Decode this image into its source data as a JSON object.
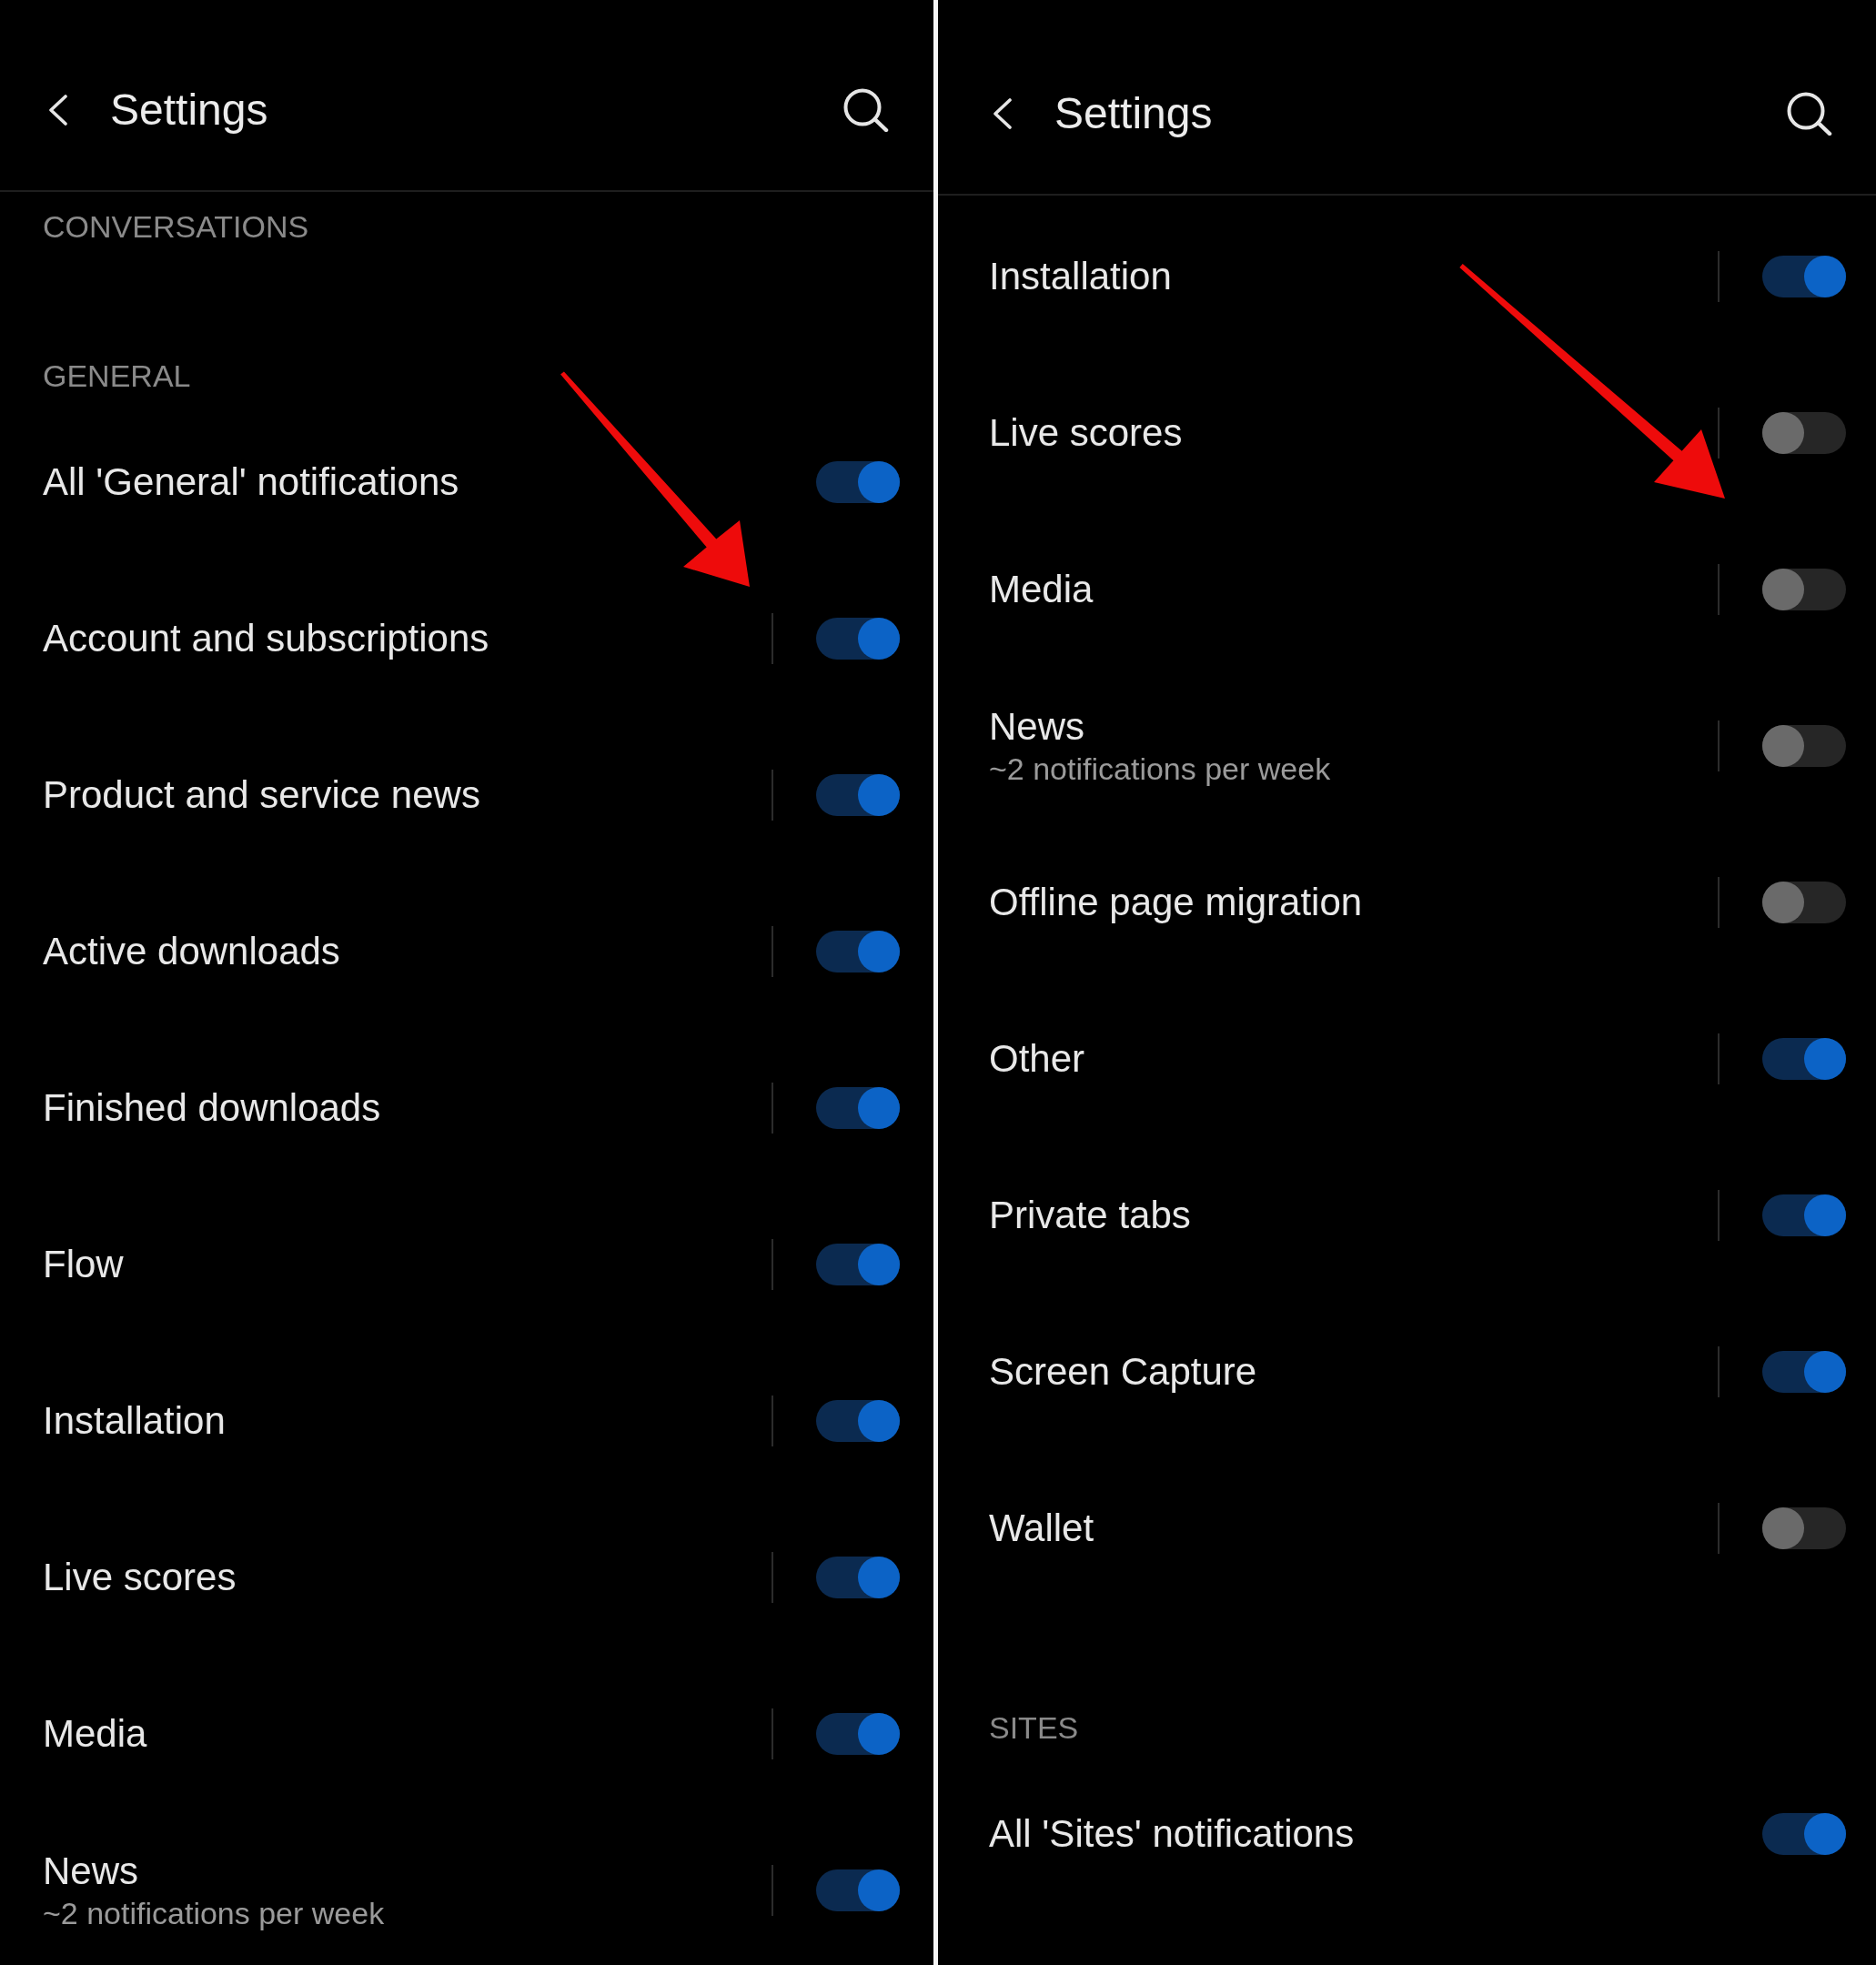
{
  "panels": [
    {
      "header": {
        "title": "Settings"
      },
      "annotation": {
        "kind": "arrow"
      },
      "sections": [
        {
          "title": "CONVERSATIONS"
        },
        {
          "title": "GENERAL",
          "rows": [
            {
              "kind": "master",
              "label": "All 'General' notifications",
              "on": true
            },
            {
              "kind": "channel",
              "label": "Account and subscriptions",
              "on": true
            },
            {
              "kind": "channel",
              "label": "Product and service news",
              "on": true
            },
            {
              "kind": "channel",
              "label": "Active downloads",
              "on": true
            },
            {
              "kind": "channel",
              "label": "Finished downloads",
              "on": true
            },
            {
              "kind": "channel",
              "label": "Flow",
              "on": true
            },
            {
              "kind": "channel",
              "label": "Installation",
              "on": true
            },
            {
              "kind": "channel",
              "label": "Live scores",
              "on": true
            },
            {
              "kind": "channel",
              "label": "Media",
              "on": true
            },
            {
              "kind": "channel",
              "label": "News",
              "subtitle": "~2 notifications per week",
              "on": true
            }
          ]
        }
      ]
    },
    {
      "header": {
        "title": "Settings"
      },
      "annotation": {
        "kind": "arrow"
      },
      "sections": [
        {
          "rows": [
            {
              "kind": "channel",
              "label": "Installation",
              "on": true
            },
            {
              "kind": "channel",
              "label": "Live scores",
              "on": false
            },
            {
              "kind": "channel",
              "label": "Media",
              "on": false
            },
            {
              "kind": "channel",
              "label": "News",
              "subtitle": "~2 notifications per week",
              "on": false
            },
            {
              "kind": "channel",
              "label": "Offline page migration",
              "on": false
            },
            {
              "kind": "channel",
              "label": "Other",
              "on": true
            },
            {
              "kind": "channel",
              "label": "Private tabs",
              "on": true
            },
            {
              "kind": "channel",
              "label": "Screen Capture",
              "on": true
            },
            {
              "kind": "channel",
              "label": "Wallet",
              "on": false
            }
          ]
        },
        {
          "title": "SITES",
          "rows": [
            {
              "kind": "master",
              "label": "All 'Sites' notifications",
              "on": true
            }
          ]
        }
      ]
    }
  ]
}
